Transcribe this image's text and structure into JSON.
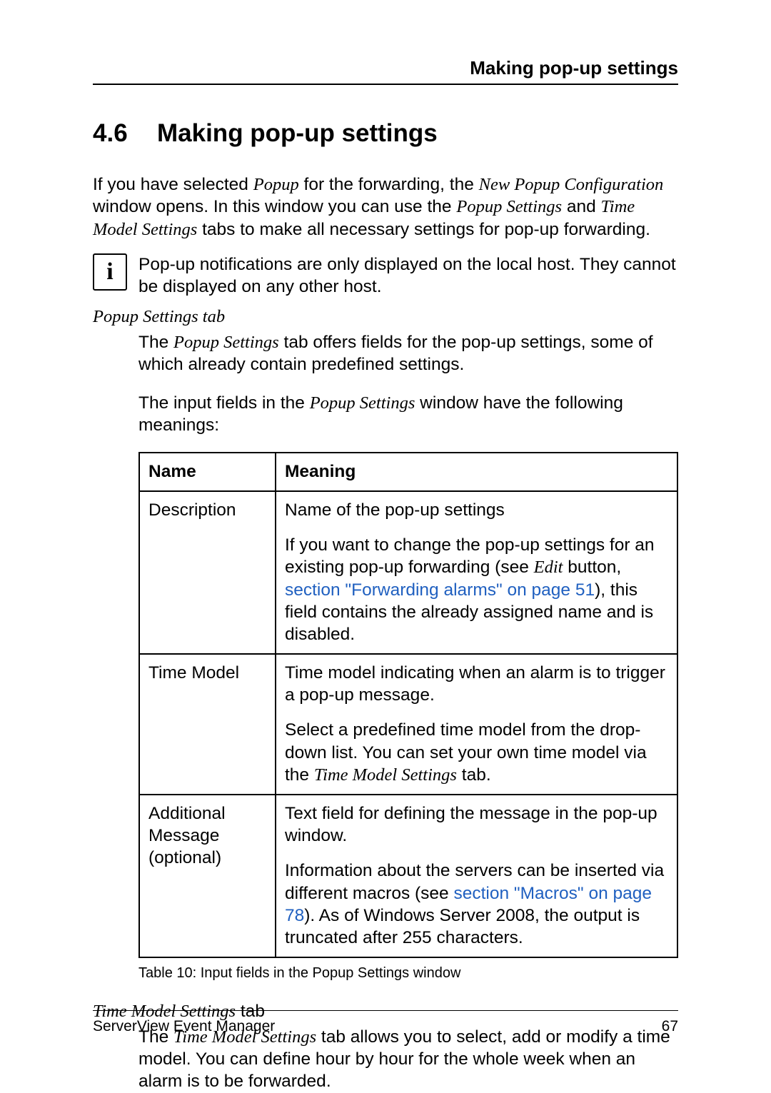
{
  "header": {
    "running_title": "Making pop-up settings"
  },
  "section": {
    "number": "4.6",
    "title": "Making pop-up settings"
  },
  "intro": {
    "part1": "If you have selected ",
    "popup": "Popup",
    "part2": " for the forwarding, the ",
    "new_popup_config": "New Popup Configuration",
    "part3": " window opens. In this window you can use the ",
    "popup_settings": "Popup Settings",
    "part4": " and ",
    "time_model_settings": "Time Model Settings",
    "part5": " tabs to make all necessary settings for pop-up forwarding."
  },
  "note": {
    "icon_glyph": "i",
    "text": "Pop-up notifications are only displayed on the local host. They cannot be displayed on any other host."
  },
  "popup_tab": {
    "heading": "Popup Settings tab",
    "p1_a": "The ",
    "p1_i": "Popup Settings",
    "p1_b": " tab offers fields for the pop-up settings, some of which already contain predefined settings.",
    "p2_a": "The input fields in the ",
    "p2_i": "Popup Settings",
    "p2_b": " window have the following meanings:"
  },
  "table": {
    "col_name": "Name",
    "col_meaning": "Meaning",
    "rows": {
      "r1": {
        "name": "Description",
        "m1": "Name of the pop-up settings",
        "m2_a": "If you want to change the pop-up settings for an existing pop-up forwarding (see ",
        "m2_edit": "Edit",
        "m2_b": " button, ",
        "m2_link": "section \"Forwarding alarms\" on page 51",
        "m2_c": "), this field contains the already assigned name and is disabled."
      },
      "r2": {
        "name": "Time Model",
        "m1": "Time model indicating when an alarm is to trigger a pop-up message.",
        "m2_a": "Select a predefined time model from the drop-down list. You can set your own time model via the ",
        "m2_i": "Time Model Settings",
        "m2_b": " tab."
      },
      "r3": {
        "name": "Additional Message (optional)",
        "m1": "Text field for defining the message in the pop-up window.",
        "m2_a": "Information about the servers can be inserted via different macros (see ",
        "m2_link": "section \"Macros\" on page 78",
        "m2_b": "). As of Windows Server 2008, the output is truncated after 255 characters."
      }
    },
    "caption": "Table 10: Input fields in the Popup Settings window"
  },
  "time_tab": {
    "heading_i": "Time Model Settings",
    "heading_b": " tab",
    "p1_a": "The ",
    "p1_i": "Time Model Settings",
    "p1_b": " tab allows you to select, add or modify a time model. You can define hour by hour for the whole week when an alarm is to be forwarded."
  },
  "footer": {
    "left": "ServerView Event Manager",
    "right": "67"
  }
}
